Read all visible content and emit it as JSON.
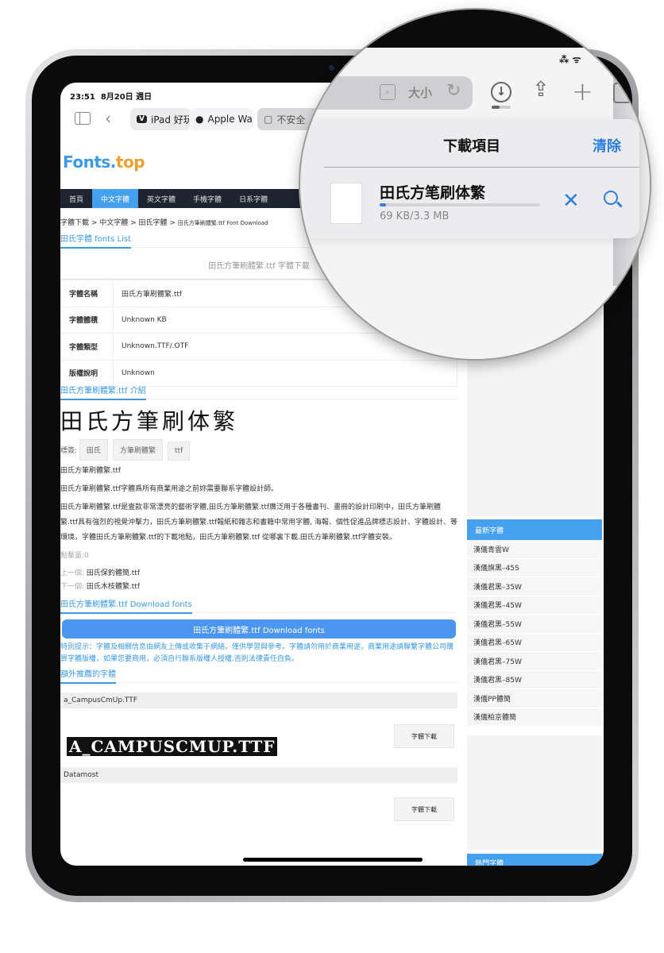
{
  "status_bar": {
    "time": "23:51",
    "date": "8月20日 週日"
  },
  "browser": {
    "tabs": [
      {
        "icon": "V",
        "label": "iPad 好玩"
      },
      {
        "icon": "",
        "label": "Apple Wa"
      },
      {
        "icon": "▢",
        "label": "不安全"
      }
    ],
    "address_text_size": "大小"
  },
  "site": {
    "logo_a": "Fonts.",
    "logo_b": "top",
    "logo_colors": {
      "a": "#3a9ae8",
      "b": "#f0a030"
    },
    "nav": [
      "首頁",
      "中文字體",
      "英文字體",
      "手機字體",
      "日系字體"
    ],
    "breadcrumb": "字體下載 > 中文字體 > 田氏字體 > ",
    "breadcrumb_current": "田氏方筆刷體繁.ttf Font Download",
    "list_heading": "田氏字體 fonts List",
    "page_heading": "田氏方筆刷體繁.ttf 字體下載",
    "info": [
      {
        "k": "字體名稱",
        "v": "田氏方筆刷體繁.ttf"
      },
      {
        "k": "字體體積",
        "v": "Unknown KB"
      },
      {
        "k": "字體類型",
        "v": "Unknown.TTF/.OTF"
      },
      {
        "k": "版權說明",
        "v": "Unknown"
      }
    ],
    "intro_heading": "田氏方筆刷體繁.ttf 介紹",
    "preview": "田氏方筆刷体繁",
    "tags_label": "標簽:",
    "tags": [
      "田氏",
      "方筆刷體繁",
      "ttf"
    ],
    "p1": "田氏方筆刷體繁.ttf",
    "p2": "田氏方筆刷體繁.ttf字體爲所有商業用途之前妳需要聯系字體設計師。",
    "p3": "田氏方筆刷體繁.ttf是壹款非常漂亮的藝術字體,田氏方筆刷體繁.ttf廣泛用于各種書刊、畫冊的設計印刷中，田氏方筆刷體繁.ttf具有強烈的視覺沖擊力，田氏方筆刷體繁.ttf報紙和雜志和書籍中常用字體, 海報、個性促進品牌標志設計、字體設計、等環境，字體田氏方筆刷體繁.ttf的下載地點，田氏方筆刷體繁.ttf 從哪裏下載.田氏方筆刷體繁.ttf字體安裝。",
    "clicks": "點擊量:0",
    "prev_label": "上一個:",
    "prev": "田氏保釣體簡.ttf",
    "next_label": "下一個:",
    "next": "田氏木枝體繁.ttf",
    "download_heading": "田氏方筆刷體繁.ttf Download fonts",
    "download_button": "田氏方筆刷體繁.ttf Download fonts",
    "notice": "特別提示：字體及相關信息由網友上傳或收集于網絡，僅供學習與參考。字體請勿用於商業用途，商業用途請聯繫字體公司購買字體版權，如果您要商用，必須自行聯系版權人授權,否則法律責任自負。",
    "recommend_heading": "額外推薦的字體",
    "recommended": [
      {
        "name": "a_CampusCmUp.TTF",
        "preview": "A_CAMPUSCMUP.TTF",
        "button": "字體下載"
      },
      {
        "name": "Datamost",
        "button": "字體下載"
      }
    ],
    "latest_heading": "最新字體",
    "latest": [
      "漢儀青雲W",
      "漢儀旗黑–45S",
      "漢儀君黑–35W",
      "漢儀君黑–45W",
      "漢儀君黑–55W",
      "漢儀君黑–65W",
      "漢儀君黑–75W",
      "漢儀君黑–85W",
      "漢儀PP體簡",
      "漢儀柏京體簡"
    ],
    "popular_heading": "熱門字體"
  },
  "downloads": {
    "title": "下載項目",
    "clear": "清除",
    "file": "田氏方笔刷体繁",
    "size": "69 KB/3.3 MB",
    "progress": 0.02,
    "accent": "#2f7fe0"
  }
}
